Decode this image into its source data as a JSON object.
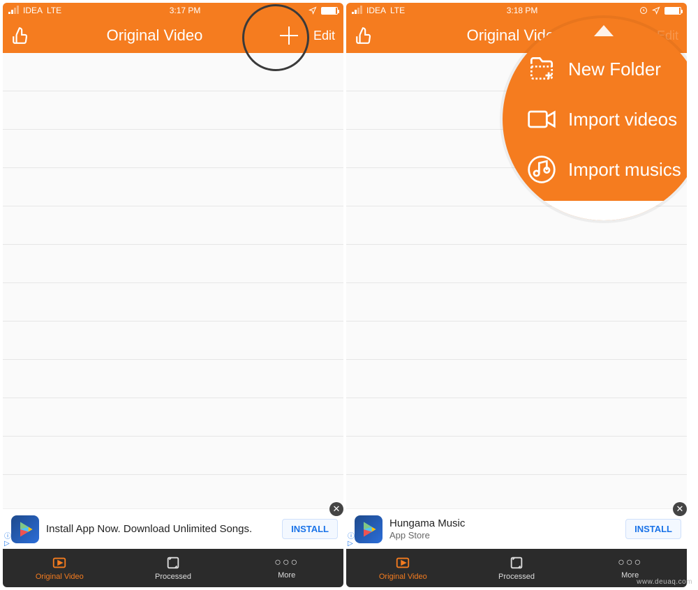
{
  "colors": {
    "accent": "#f57c1f",
    "tabbar": "#2b2b2b",
    "install": "#1a73e8"
  },
  "screens": [
    {
      "status": {
        "carrier": "IDEA",
        "network": "LTE",
        "time": "3:17 PM"
      },
      "nav": {
        "title": "Original Video",
        "edit": "Edit"
      },
      "ad": {
        "line1": "Install App Now. Download Unlimited Songs.",
        "line2": "",
        "cta": "INSTALL"
      }
    },
    {
      "status": {
        "carrier": "IDEA",
        "network": "LTE",
        "time": "3:18 PM"
      },
      "nav": {
        "title": "Original Video",
        "edit": "Edit"
      },
      "ad": {
        "line1": "Hungama Music",
        "line2": "App Store",
        "cta": "INSTALL"
      }
    }
  ],
  "tabs": [
    {
      "label": "Original Video"
    },
    {
      "label": "Processed"
    },
    {
      "label": "More"
    }
  ],
  "popup": {
    "items": [
      "New Folder",
      "Import videos",
      "Import musics"
    ]
  },
  "watermark": "www.deuaq.com"
}
